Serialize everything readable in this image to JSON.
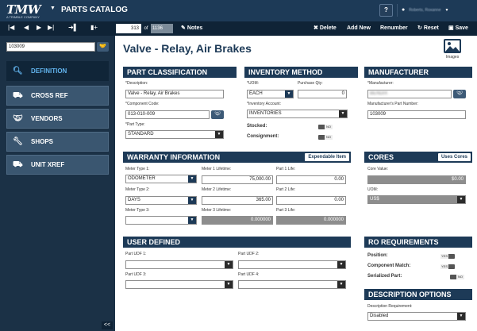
{
  "app": {
    "logo": "TMW",
    "logo_sub": "A TRIMBLE COMPANY",
    "title": "PARTS CATALOG",
    "help": "?",
    "user_name": "Roberts, Roxanne"
  },
  "toolbar": {
    "record_current": "313",
    "record_of": "of",
    "record_total": "1136",
    "notes_label": "Notes",
    "delete_label": "Delete",
    "add_new_label": "Add New",
    "renumber_label": "Renumber",
    "reset_label": "Reset",
    "save_label": "Save"
  },
  "sidebar": {
    "search_value": "103009",
    "items": [
      {
        "label": "DEFINITION",
        "icon": "search-icon",
        "active": true
      },
      {
        "label": "CROSS REF",
        "icon": "truck-icon",
        "active": false
      },
      {
        "label": "VENDORS",
        "icon": "handshake-icon",
        "active": false
      },
      {
        "label": "SHOPS",
        "icon": "wrench-icon",
        "active": false
      },
      {
        "label": "UNIT XREF",
        "icon": "truck-icon",
        "active": false
      }
    ],
    "collapse": "<<"
  },
  "page": {
    "title": "Valve - Relay, Air Brakes",
    "images_label": "Images"
  },
  "part_classification": {
    "title": "PART CLASSIFICATION",
    "description_label": "*Description:",
    "description_value": "Valve - Relay, Air Brakes",
    "component_code_label": "*Component Code:",
    "component_code_value": "013-010-009",
    "part_type_label": "*Part Type:",
    "part_type_value": "STANDARD"
  },
  "inventory_method": {
    "title": "INVENTORY METHOD",
    "uom_label": "*UOM:",
    "uom_value": "EACH",
    "purchase_qty_label": "Purchase Qty:",
    "purchase_qty_value": "0",
    "inventory_account_label": "*Inventory Account:",
    "inventory_account_value": "INVENTORIES",
    "stocked_label": "Stocked:",
    "stocked_value": "NO",
    "consignment_label": "Consignment:",
    "consignment_value": "NO"
  },
  "manufacturer": {
    "title": "MANUFACTURER",
    "manufacturer_label": "*Manufacturer:",
    "manufacturer_value": "BENDIX",
    "part_number_label": "Manufacturer's Part Number:",
    "part_number_value": "103009"
  },
  "warranty": {
    "title": "WARRANTY INFORMATION",
    "expendable_label": "Expendable Item",
    "meter1_type_label": "Meter Type 1:",
    "meter1_type_value": "ODOMETER",
    "meter1_lifetime_label": "Meter 1 Lifetime:",
    "meter1_lifetime_value": "75,000.00",
    "part1_life_label": "Part 1 Life:",
    "part1_life_value": "0.00",
    "meter2_type_label": "Meter Type 2:",
    "meter2_type_value": "DAYS",
    "meter2_lifetime_label": "Meter 2 Lifetime:",
    "meter2_lifetime_value": "365.00",
    "part2_life_label": "Part 2 Life:",
    "part2_life_value": "0.00",
    "meter3_type_label": "Meter Type 3:",
    "meter3_type_value": "",
    "meter3_lifetime_label": "Meter 3 Lifetime:",
    "meter3_lifetime_value": "0.000000",
    "part3_life_label": "Part 3 Life:",
    "part3_life_value": "0.000000"
  },
  "cores": {
    "title": "CORES",
    "uses_cores_label": "Uses Cores",
    "core_value_label": "Core Value:",
    "core_value_value": "$0.00",
    "uom_label": "UOM:",
    "uom_value": "US$"
  },
  "user_defined": {
    "title": "USER DEFINED",
    "udf1_label": "Part UDF 1:",
    "udf2_label": "Part UDF 2:",
    "udf3_label": "Part UDF 3:",
    "udf4_label": "Part UDF 4:"
  },
  "ro_requirements": {
    "title": "RO REQUIREMENTS",
    "position_label": "Position:",
    "position_value": "YES",
    "component_match_label": "Component Match:",
    "component_match_value": "YES",
    "serialized_label": "Serialized Part:",
    "serialized_value": "NO"
  },
  "description_options": {
    "title": "DESCRIPTION OPTIONS",
    "requirement_label": "Description Requirement:",
    "requirement_value": "Disabled"
  },
  "colors": {
    "header_navy": "#1d3a57",
    "sidebar_bg": "#1b3146",
    "active_blue": "#62b4ee"
  }
}
